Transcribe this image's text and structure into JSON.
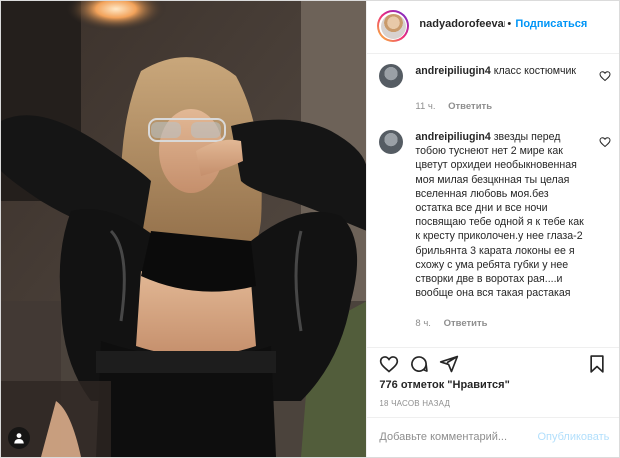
{
  "post": {
    "username": "nadyadorofeevana",
    "separator": "•",
    "follow_label": "Подписаться"
  },
  "comments": [
    {
      "username": "andreipiliugin4",
      "text": "класс костюмчик",
      "time": "11 ч.",
      "reply_label": "Ответить"
    },
    {
      "username": "andreipiliugin4",
      "text": "звезды перед тобою туснеют нет 2 мире как цветут орхидеи необыкновенная моя милая безцкнная ты целая вселенная любовь моя.без остатка все дни и все ночи посвящаю тебе одной я к тебе как к кресту приколочен.у нее глаза-2 брильянта 3 карата локоны ее я схожу с ума ребята губки у нее створки две в воротах рая....и вообще она вся такая растакая",
      "time": "8 ч.",
      "reply_label": "Ответить"
    }
  ],
  "actions": {
    "icons": [
      "heart-icon",
      "comment-icon",
      "share-icon",
      "bookmark-icon"
    ]
  },
  "likes_text": "776 отметок \"Нравится\"",
  "timestamp": "18 ЧАСОВ НАЗАД",
  "add_comment": {
    "placeholder": "Добавьте комментарий...",
    "post_label": "Опубликовать"
  },
  "colors": {
    "accent": "#0095f6",
    "text": "#262626",
    "secondary": "#8e8e8e",
    "post_disabled": "#b2dffc"
  }
}
